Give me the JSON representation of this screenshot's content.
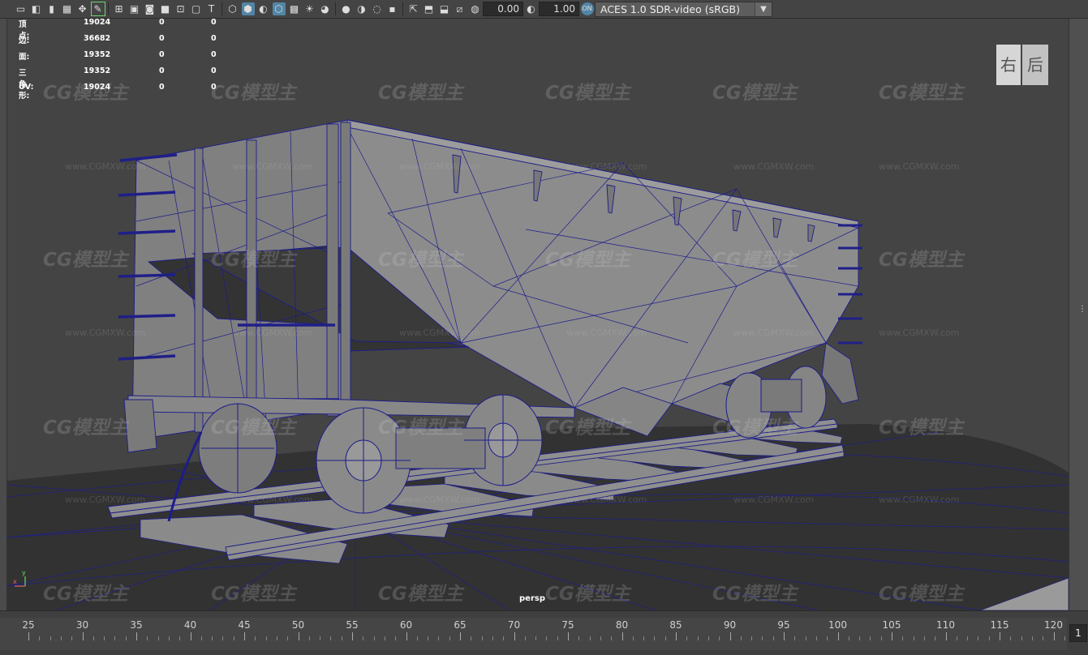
{
  "toolbar": {
    "icons": [
      "camera-attributes",
      "camera-lock",
      "bookmark",
      "image-plane",
      "two-d-pan",
      "grease-pencil",
      "grid",
      "film-gate",
      "resolution-gate",
      "gate-mask",
      "field-chart",
      "safe-action",
      "safe-title",
      "wireframe",
      "smooth-shade",
      "default-material",
      "wireframe-on-shaded",
      "xray",
      "use-all-lights",
      "shadows",
      "screen-space-ao",
      "motion-blur",
      "multisample-aa",
      "depth-of-field",
      "isolate-select",
      "xray-joints",
      "xray-active",
      "backface-culling"
    ],
    "exposure_value": "0.00",
    "gamma_value": "1.00",
    "color_space": "ACES 1.0 SDR-video (sRGB)",
    "colorspace_badge": "ON"
  },
  "hud": {
    "rows": [
      {
        "label": "顶点:",
        "value": "19024",
        "col2": "0",
        "col3": "0"
      },
      {
        "label": "边:",
        "value": "36682",
        "col2": "0",
        "col3": "0"
      },
      {
        "label": "面:",
        "value": "19352",
        "col2": "0",
        "col3": "0"
      },
      {
        "label": "三角形:",
        "value": "19352",
        "col2": "0",
        "col3": "0"
      },
      {
        "label": "UV:",
        "value": "19024",
        "col2": "0",
        "col3": "0"
      }
    ]
  },
  "viewcube": {
    "right": "右",
    "back": "后"
  },
  "camera_label": "persp",
  "axis": {
    "y": "y",
    "x": "x"
  },
  "watermark": {
    "logo": "CG模型主",
    "url": "www.CGMXW.com"
  },
  "timeline": {
    "labels": [
      "25",
      "30",
      "35",
      "40",
      "45",
      "50",
      "55",
      "60",
      "65",
      "70",
      "75",
      "80",
      "85",
      "90",
      "95",
      "100",
      "105",
      "110",
      "115",
      "120"
    ],
    "current_frame": "1"
  },
  "colors": {
    "wire": "#1a1a8c",
    "mesh": "#7e7e7e",
    "background": "#444444"
  }
}
